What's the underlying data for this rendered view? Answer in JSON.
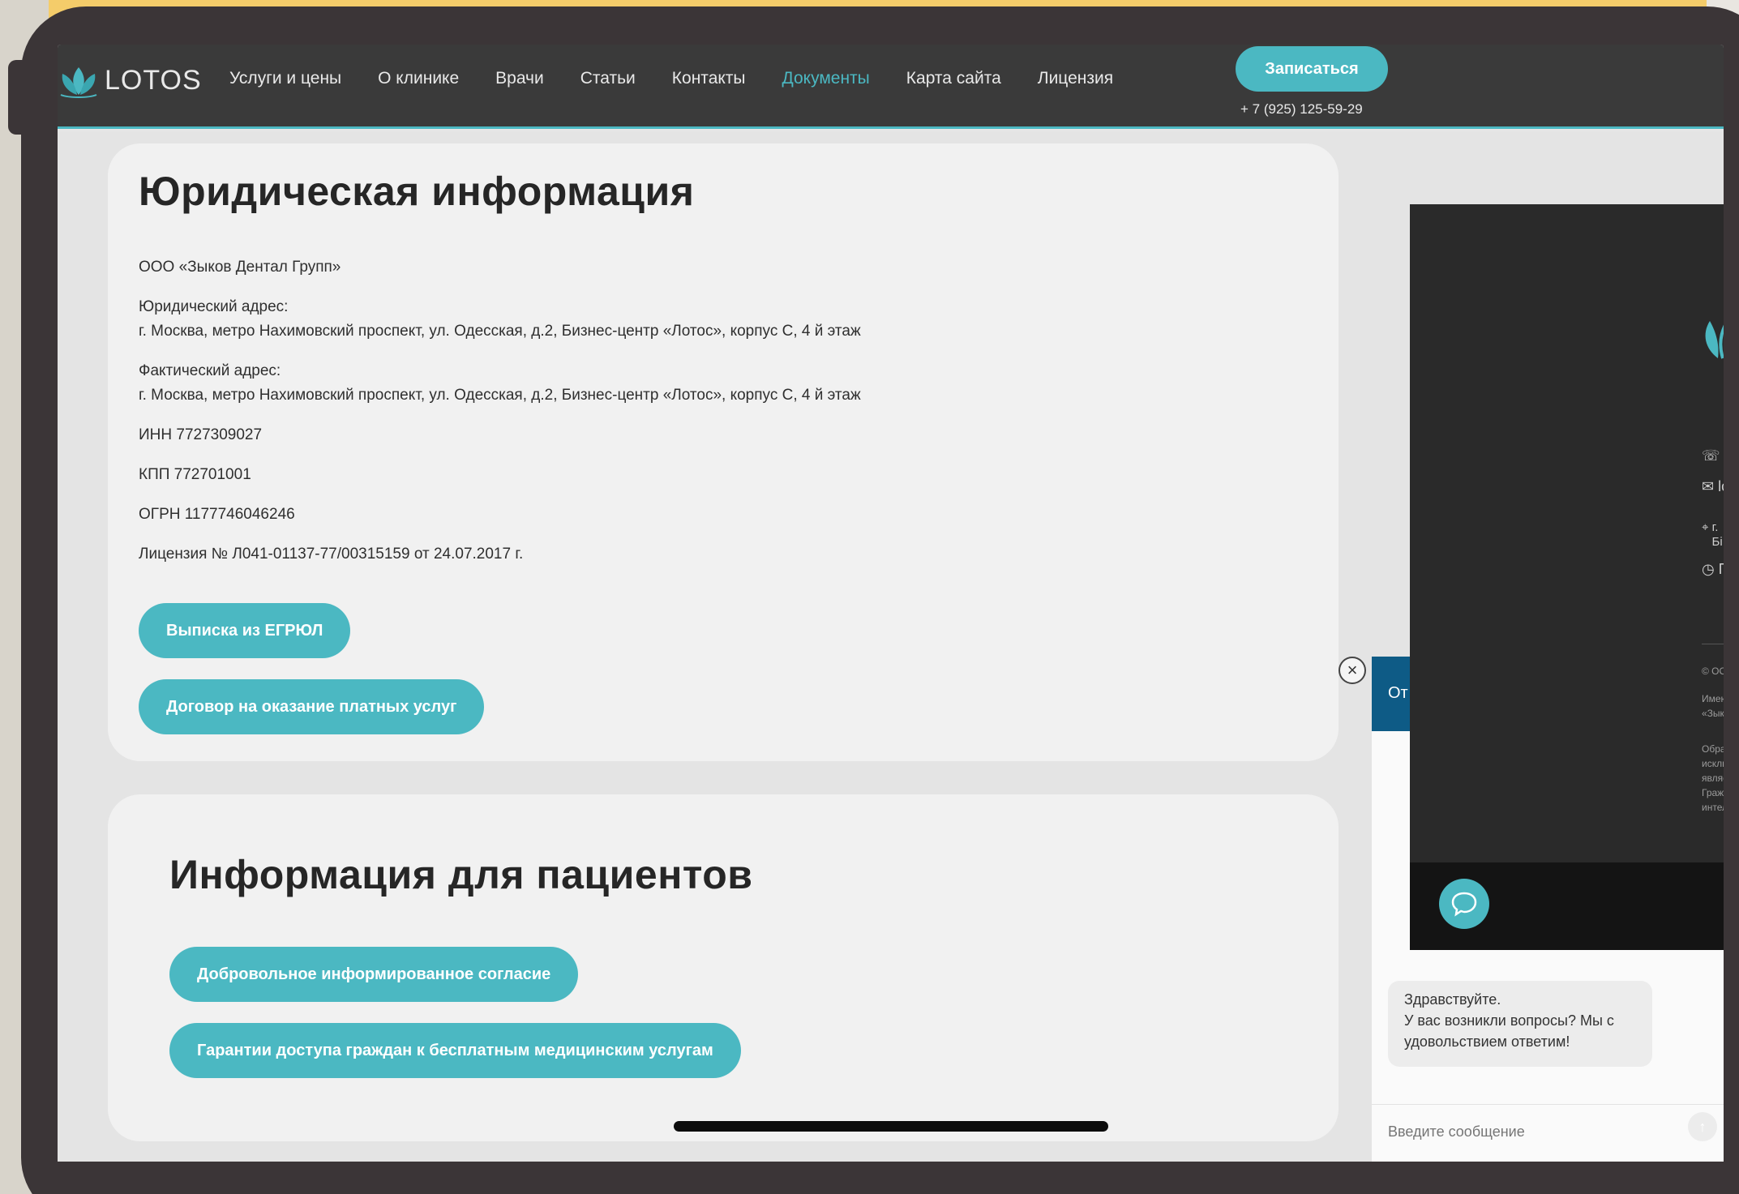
{
  "header": {
    "logo_text": "LOTOS",
    "nav": [
      {
        "label": "Услуги и цены",
        "active": false
      },
      {
        "label": "О клинике",
        "active": false
      },
      {
        "label": "Врачи",
        "active": false
      },
      {
        "label": "Статьи",
        "active": false
      },
      {
        "label": "Контакты",
        "active": false
      },
      {
        "label": "Документы",
        "active": true
      },
      {
        "label": "Карта сайта",
        "active": false
      },
      {
        "label": "Лицензия",
        "active": false
      }
    ],
    "signup_label": "Записаться",
    "phone": "+ 7 (925) 125-59-29"
  },
  "legal": {
    "title": "Юридическая информация",
    "company": "ООО «Зыков Дентал Групп»",
    "legal_address_label": "Юридический адрес:",
    "legal_address": "г. Москва, метро Нахимовский проспект, ул. Одесская, д.2, Бизнес-центр «Лотос», корпус С, 4 й этаж",
    "actual_address_label": "Фактический адрес:",
    "actual_address": "г. Москва, метро Нахимовский проспект, ул. Одесская, д.2, Бизнес-центр «Лотос», корпус С, 4 й этаж",
    "inn": "ИНН 7727309027",
    "kpp": "КПП 772701001",
    "ogrn": "ОГРН 1177746046246",
    "license": "Лицензия № Л041-01137-77/00315159 от 24.07.2017 г.",
    "btn_egrul": "Выписка из ЕГРЮЛ",
    "btn_contract": "Договор на оказание платных услуг"
  },
  "patients": {
    "title": "Информация для пациентов",
    "btn_consent": "Добровольное информированное согласие",
    "btn_guarantees": "Гарантии доступа граждан к бесплатным медицинским услугам"
  },
  "chat": {
    "header_fragment": "От",
    "greeting_line1": "Здравствуйте.",
    "greeting_line2": "У вас возникли вопросы? Мы с",
    "greeting_line3": "удовольствием ответим!",
    "input_placeholder": "Введите сообщение"
  },
  "dark_panel": {
    "phone_fragment": "+",
    "email_fragment": "lc",
    "address_fragment_1": "г.",
    "address_fragment_2": "Бі",
    "hours_fragment": "П",
    "copyright_fragment": "© ООО",
    "text_fragments": [
      "Имеют",
      "«Зыков",
      "Обращ",
      "исклю",
      "являет",
      "Гражд",
      "интелл"
    ]
  },
  "colors": {
    "accent": "#4bb8c2",
    "header_bg": "#3a3a3a",
    "chat_header": "#0e5b86"
  }
}
